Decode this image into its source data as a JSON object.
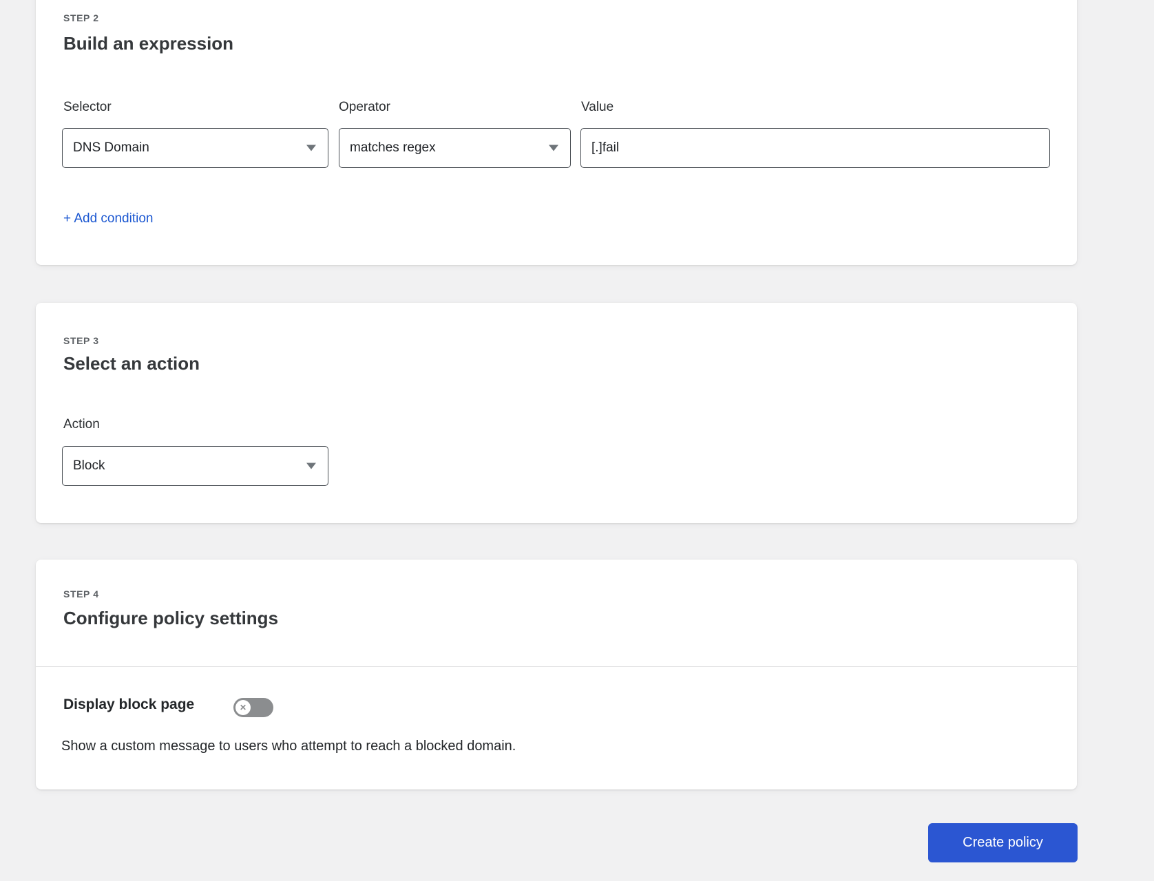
{
  "colors": {
    "page_background": "#f1f1f2",
    "accent_blue": "#2b56d2",
    "link_blue": "#1b57d1",
    "toggle_off_gray": "#8b8d8f",
    "input_border": "#464b51"
  },
  "icons": {
    "dropdown_caret": "chevron-down-icon",
    "toggle_knob_glyph": "✕"
  },
  "cards": {
    "expression": {
      "step_label": "STEP 2",
      "title": "Build an expression",
      "fields": {
        "selector": {
          "label": "Selector",
          "value": "DNS Domain"
        },
        "operator": {
          "label": "Operator",
          "value": "matches regex"
        },
        "value": {
          "label": "Value",
          "value": "[.]fail"
        }
      },
      "add_condition_label": "+ Add condition"
    },
    "action": {
      "step_label": "STEP 3",
      "title": "Select an action",
      "fields": {
        "action": {
          "label": "Action",
          "value": "Block"
        }
      }
    },
    "settings": {
      "step_label": "STEP 4",
      "title": "Configure policy settings",
      "display_block_page": {
        "label": "Display block page",
        "toggle_state": "off",
        "description": "Show a custom message to users who attempt to reach a blocked domain."
      }
    }
  },
  "footer": {
    "create_button_label": "Create policy"
  }
}
